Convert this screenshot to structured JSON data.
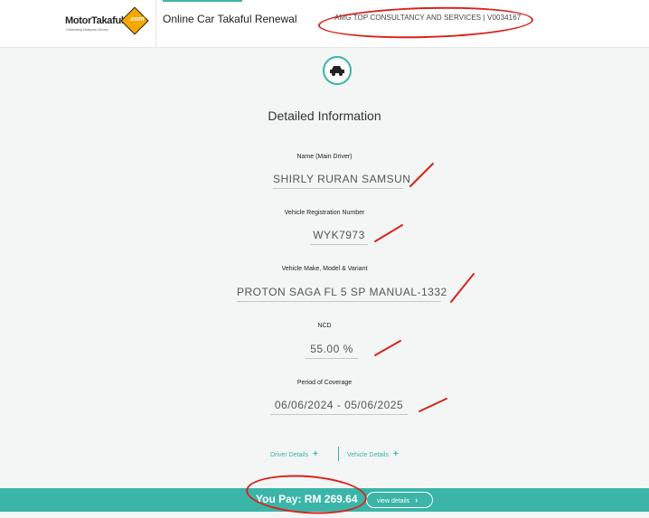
{
  "header": {
    "logo": {
      "wordmark": "MotorTakaful",
      "domain_suffix": ".com",
      "tagline": "Celebrating Malaysian Drivers"
    },
    "title": "Online Car Takaful Renewal",
    "agent": "AMG TOP CONSULTANCY AND SERVICES | V0034167"
  },
  "main": {
    "icon": "car-icon",
    "section_title": "Detailed Information",
    "fields": [
      {
        "label": "Name (Main Driver)",
        "value": "SHIRLY RURAN SAMSUN"
      },
      {
        "label": "Vehicle Registration Number",
        "value": "WYK7973"
      },
      {
        "label": "Vehicle Make, Model & Variant",
        "value": "PROTON SAGA FL 5 SP MANUAL-1332"
      },
      {
        "label": "NCD",
        "value": "55.00 %"
      },
      {
        "label": "Period of Coverage",
        "value": "06/06/2024 - 05/06/2025"
      }
    ],
    "links": {
      "driver_details": "Driver Details",
      "vehicle_details": "Vehicle Details"
    }
  },
  "footer": {
    "pay_text": "You Pay: RM 269.64",
    "view_details": "view details"
  },
  "colors": {
    "accent": "#3ab5a8",
    "annotation_red": "#d8231c",
    "logo_orange": "#f6a800",
    "background": "#f4f5f5"
  }
}
